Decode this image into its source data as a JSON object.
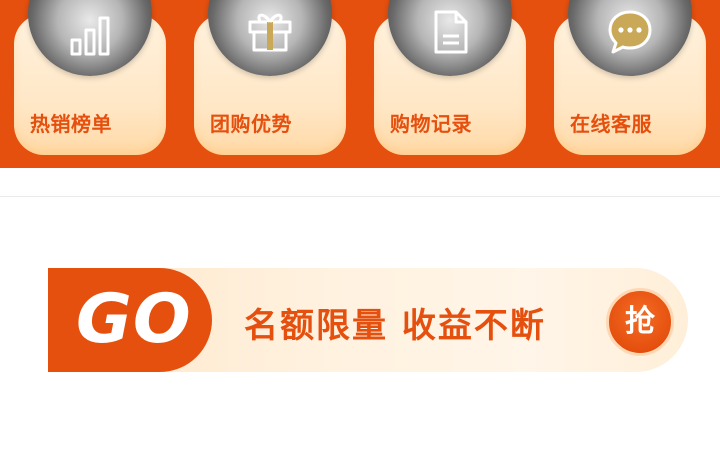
{
  "colors": {
    "accent": "#e5500f",
    "card_background": "#ffe7c6",
    "banner_background": "#fff1de"
  },
  "entries": [
    {
      "label": "热销榜单",
      "icon": "bar-chart-icon"
    },
    {
      "label": "团购优势",
      "icon": "gift-icon"
    },
    {
      "label": "购物记录",
      "icon": "document-icon"
    },
    {
      "label": "在线客服",
      "icon": "chat-icon"
    }
  ],
  "banner": {
    "badge": "GO",
    "text": "名额限量 收益不断",
    "button": "抢"
  }
}
